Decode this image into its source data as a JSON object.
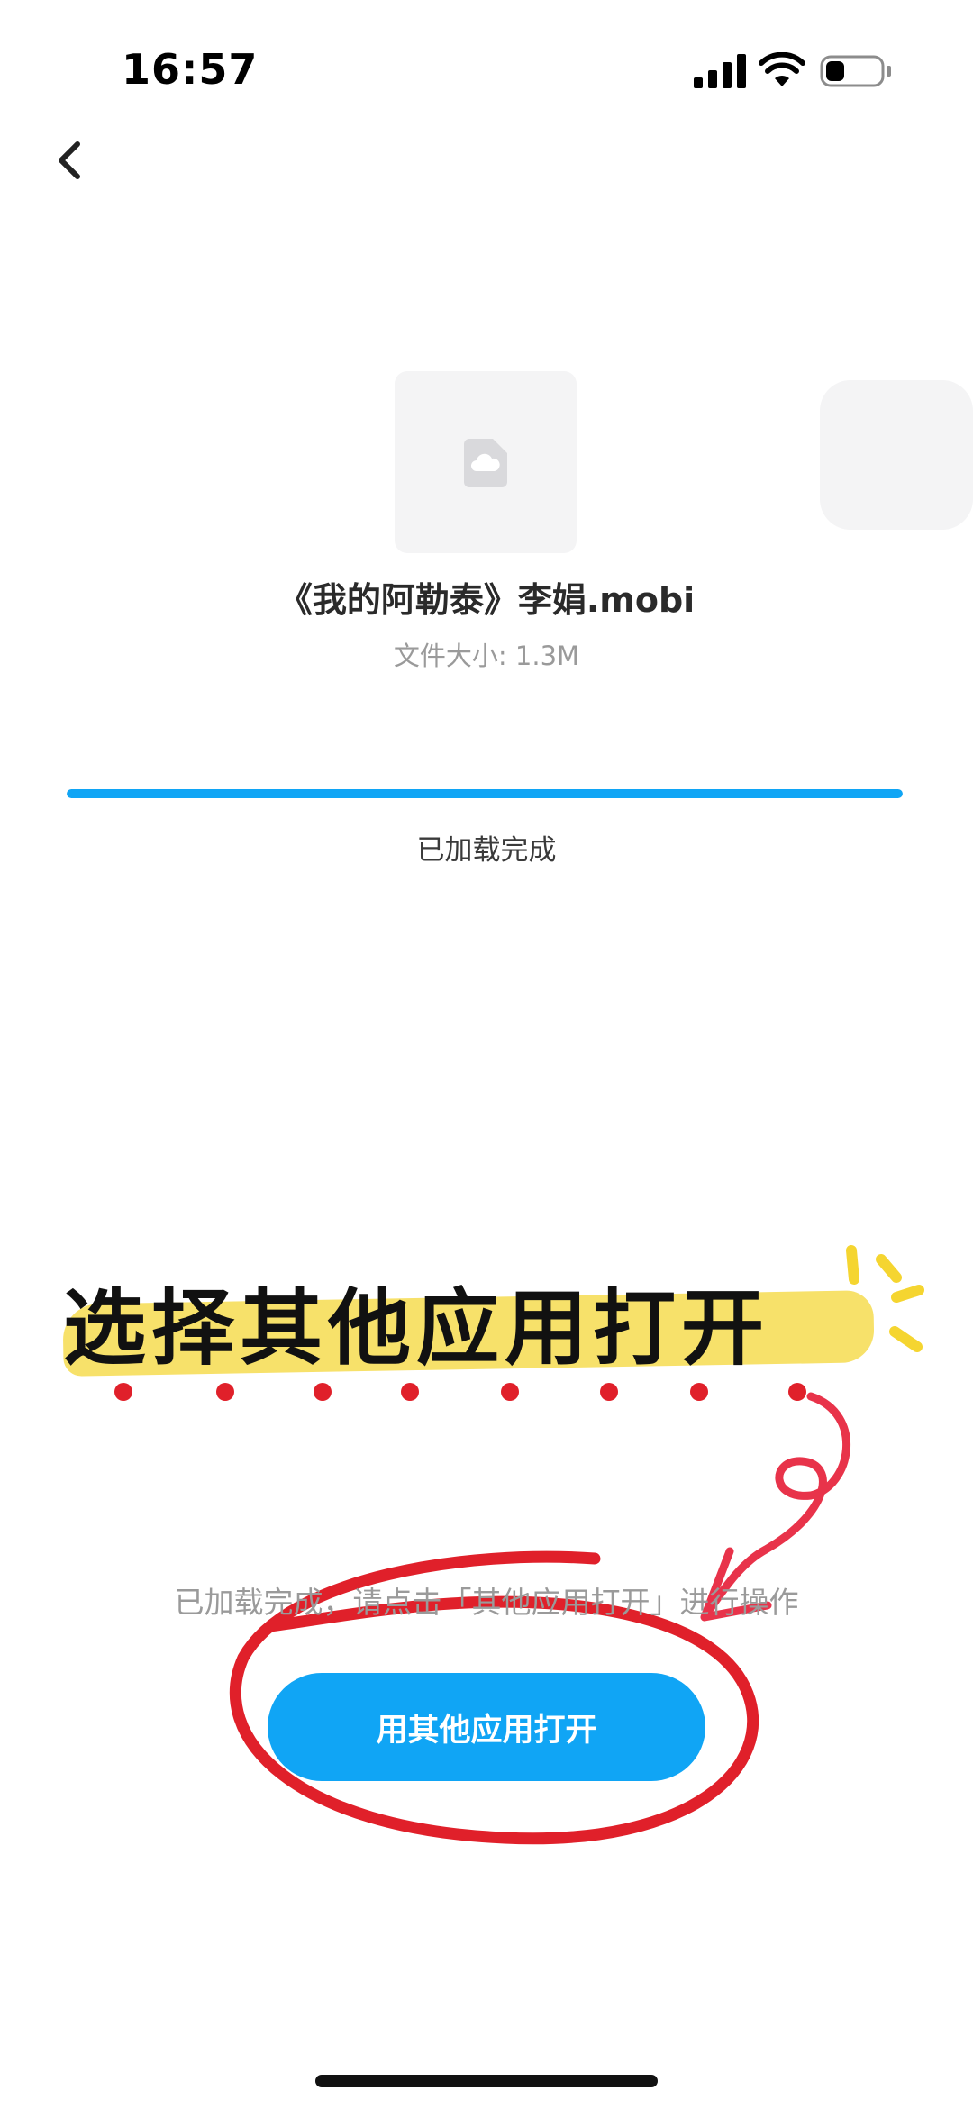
{
  "status_bar": {
    "time": "16:57",
    "icons": [
      "signal-icon",
      "wifi-icon",
      "battery-icon"
    ],
    "battery_level": 0.35
  },
  "nav": {
    "back_icon": "chevron-left-icon"
  },
  "file": {
    "thumbnail_icon": "file-cloud-icon",
    "name": "《我的阿勒泰》李娟.mobi",
    "size_label": "文件大小: ",
    "size_value": "1.3M"
  },
  "progress": {
    "percent": 100,
    "label": "已加载完成"
  },
  "annotation": {
    "title": "选择其他应用打开"
  },
  "hint": {
    "text": "已加载完成，请点击「其他应用打开」进行操作"
  },
  "primary_action": {
    "label": "用其他应用打开"
  },
  "colors": {
    "accent": "#10a5f5",
    "annotation_red": "#e0202a",
    "annotation_yellow": "#f7e16a",
    "annotation_pink": "#e8334a"
  }
}
